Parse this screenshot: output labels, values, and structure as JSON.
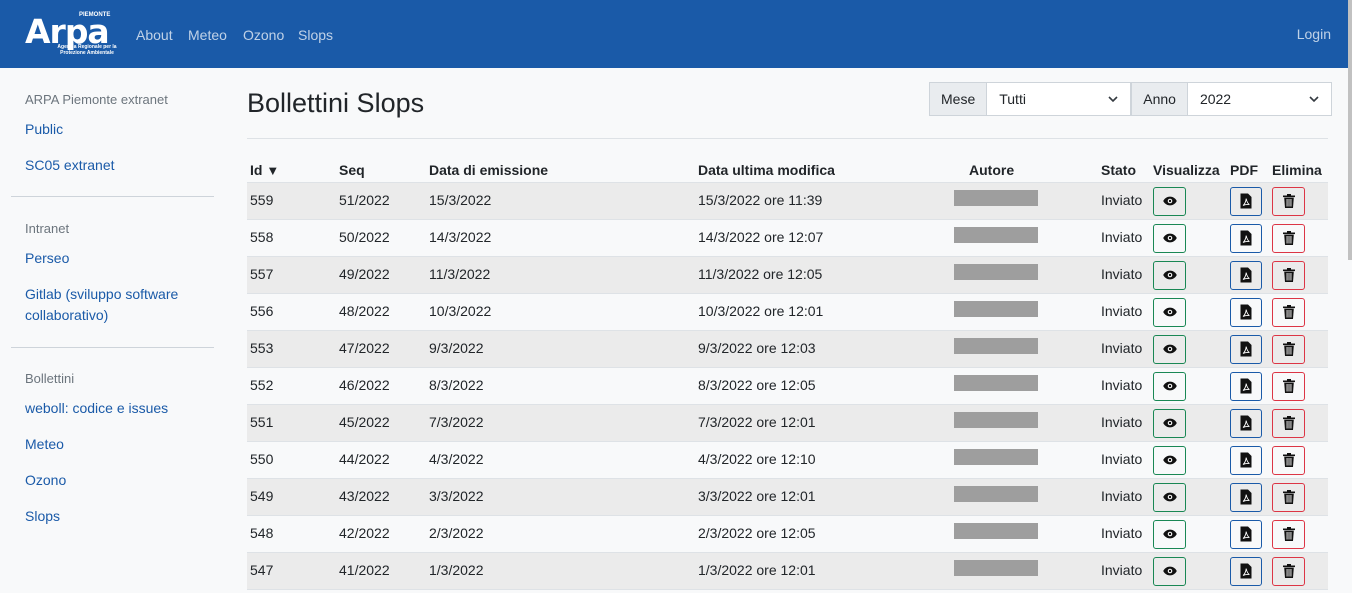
{
  "brand": {
    "name": "Arpa",
    "top": "PIEMONTE",
    "subtitle": "Agenzia Regionale per la Protezione Ambientale"
  },
  "nav": {
    "items": [
      "About",
      "Meteo",
      "Ozono",
      "Slops"
    ],
    "login": "Login"
  },
  "sidebar": {
    "sections": [
      {
        "heading": "ARPA Piemonte extranet",
        "links": [
          "Public",
          "SC05 extranet"
        ]
      },
      {
        "heading": "Intranet",
        "links": [
          "Perseo",
          "Gitlab (sviluppo software collaborativo)"
        ]
      },
      {
        "heading": "Bollettini",
        "links": [
          "weboll: codice e issues",
          "Meteo",
          "Ozono",
          "Slops"
        ]
      }
    ]
  },
  "page": {
    "title": "Bollettini Slops"
  },
  "filters": {
    "mese_label": "Mese",
    "mese_value": "Tutti",
    "anno_label": "Anno",
    "anno_value": "2022"
  },
  "table": {
    "headers": {
      "id": "Id",
      "sort_indicator": "▼",
      "seq": "Seq",
      "emission": "Data di emissione",
      "modified": "Data ultima modifica",
      "author": "Autore",
      "status": "Stato",
      "view": "Visualizza",
      "pdf": "PDF",
      "delete": "Elimina"
    },
    "rows": [
      {
        "id": "559",
        "seq": "51/2022",
        "emission": "15/3/2022",
        "modified": "15/3/2022 ore 11:39",
        "status": "Inviato"
      },
      {
        "id": "558",
        "seq": "50/2022",
        "emission": "14/3/2022",
        "modified": "14/3/2022 ore 12:07",
        "status": "Inviato"
      },
      {
        "id": "557",
        "seq": "49/2022",
        "emission": "11/3/2022",
        "modified": "11/3/2022 ore 12:05",
        "status": "Inviato"
      },
      {
        "id": "556",
        "seq": "48/2022",
        "emission": "10/3/2022",
        "modified": "10/3/2022 ore 12:01",
        "status": "Inviato"
      },
      {
        "id": "553",
        "seq": "47/2022",
        "emission": "9/3/2022",
        "modified": "9/3/2022 ore 12:03",
        "status": "Inviato"
      },
      {
        "id": "552",
        "seq": "46/2022",
        "emission": "8/3/2022",
        "modified": "8/3/2022 ore 12:05",
        "status": "Inviato"
      },
      {
        "id": "551",
        "seq": "45/2022",
        "emission": "7/3/2022",
        "modified": "7/3/2022 ore 12:01",
        "status": "Inviato"
      },
      {
        "id": "550",
        "seq": "44/2022",
        "emission": "4/3/2022",
        "modified": "4/3/2022 ore 12:10",
        "status": "Inviato"
      },
      {
        "id": "549",
        "seq": "43/2022",
        "emission": "3/3/2022",
        "modified": "3/3/2022 ore 12:01",
        "status": "Inviato"
      },
      {
        "id": "548",
        "seq": "42/2022",
        "emission": "2/3/2022",
        "modified": "2/3/2022 ore 12:05",
        "status": "Inviato"
      },
      {
        "id": "547",
        "seq": "41/2022",
        "emission": "1/3/2022",
        "modified": "1/3/2022 ore 12:01",
        "status": "Inviato"
      }
    ]
  },
  "colors": {
    "navbar": "#1a5aa8",
    "view_button": "#198754",
    "pdf_button": "#1a5aa8",
    "delete_button": "#dc3545"
  },
  "icons": {
    "view": "eye-icon",
    "pdf": "pdf-file-icon",
    "delete": "trash-icon",
    "select": "chevron-down-icon"
  }
}
